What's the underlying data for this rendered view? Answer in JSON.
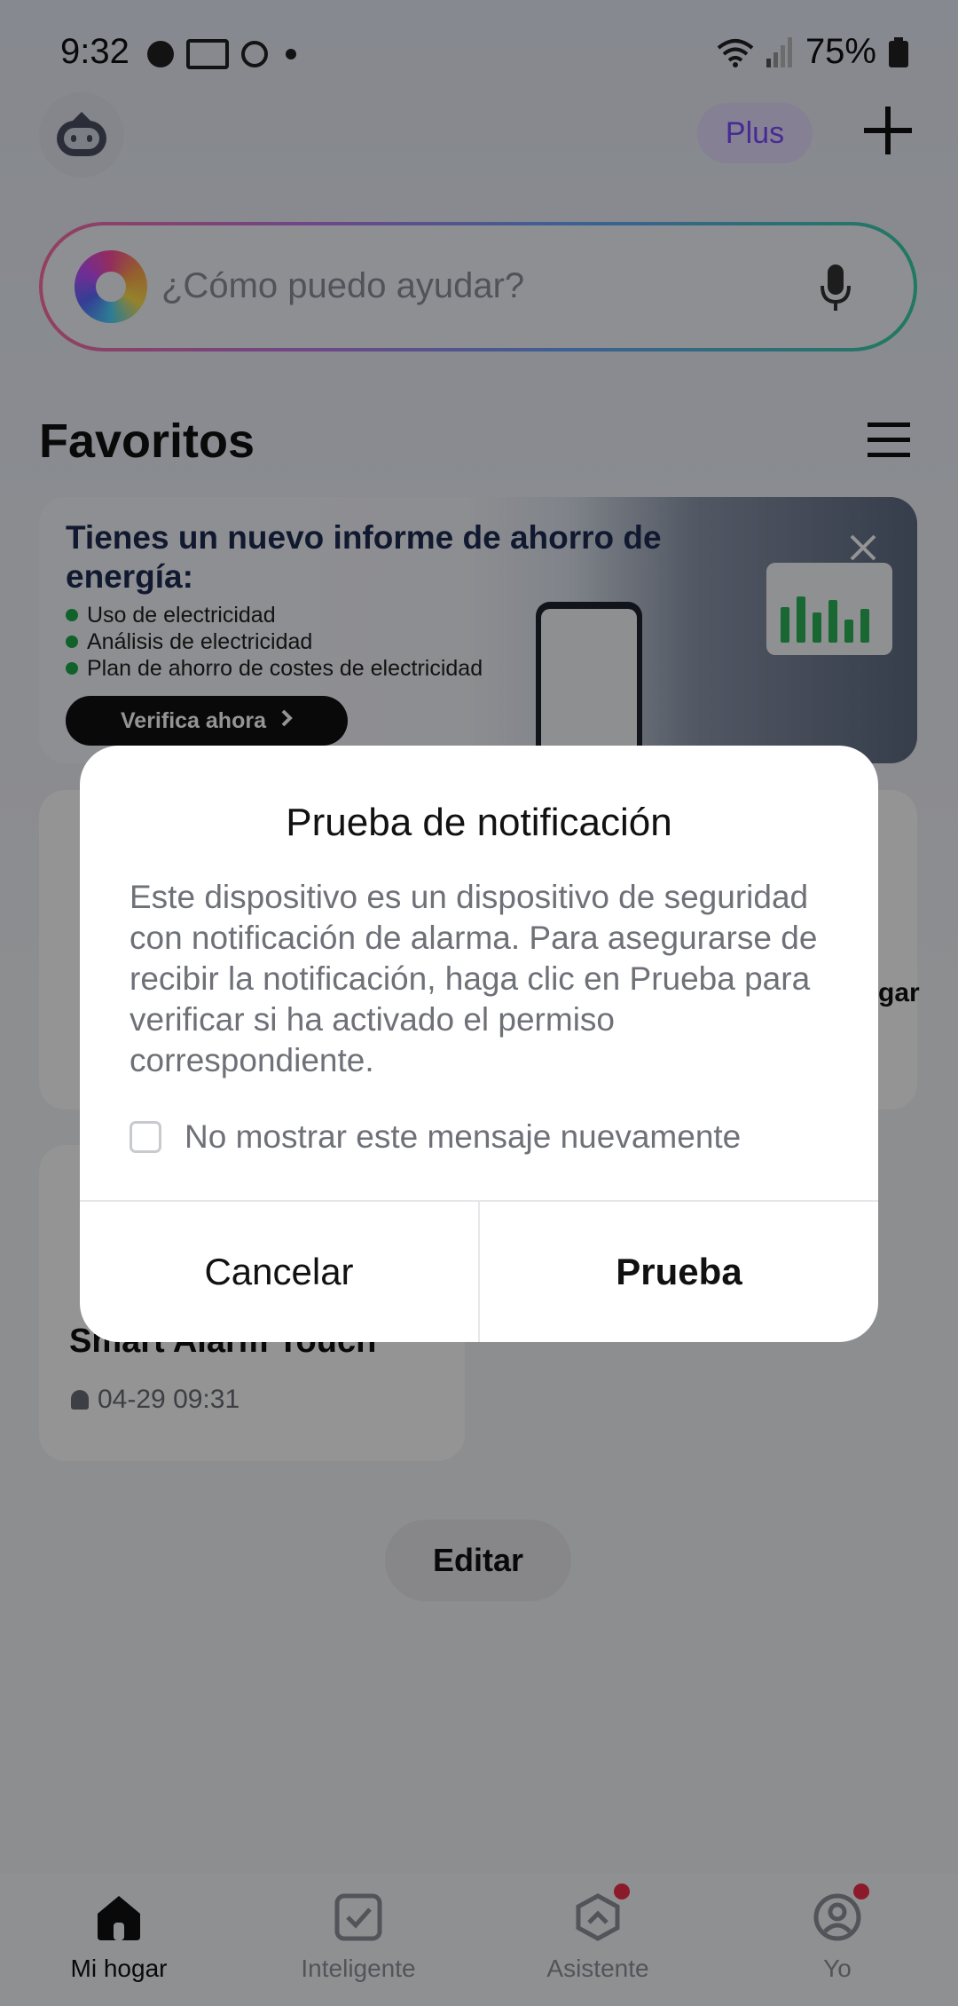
{
  "status_bar": {
    "time": "9:32",
    "battery": "75%"
  },
  "header": {
    "plus_label": "Plus"
  },
  "search": {
    "placeholder": "¿Cómo puedo ayudar?"
  },
  "favorites": {
    "title": "Favoritos"
  },
  "banner": {
    "title": "Tienes un nuevo informe de ahorro de energía:",
    "items": [
      "Uso de electricidad",
      "Análisis de electricidad",
      "Plan de ahorro de costes de electricidad"
    ],
    "button_label": "Verifica ahora"
  },
  "device_card": {
    "partial_text": "gar",
    "name": "Smart Alarm Touch",
    "time": "04-29 09:31"
  },
  "edit_label": "Editar",
  "dialog": {
    "title": "Prueba de notificación",
    "body": "Este dispositivo es un dispositivo de seguridad con notificación de alarma. Para asegurarse de recibir la notificación, haga clic en Prueba para verificar si ha activado el permiso correspondiente.",
    "checkbox_label": "No mostrar este mensaje nuevamente",
    "cancel_label": "Cancelar",
    "test_label": "Prueba"
  },
  "nav": {
    "items": [
      {
        "label": "Mi hogar",
        "icon": "home-icon",
        "active": true
      },
      {
        "label": "Inteligente",
        "icon": "smart-check-icon",
        "active": false
      },
      {
        "label": "Asistente",
        "icon": "assistant-icon",
        "active": false,
        "badge": true
      },
      {
        "label": "Yo",
        "icon": "profile-icon",
        "active": false,
        "badge": true
      }
    ]
  },
  "colors": {
    "accent_purple": "#7b4bff",
    "badge_red": "#f0304a",
    "bullet_green": "#1ea84a"
  }
}
